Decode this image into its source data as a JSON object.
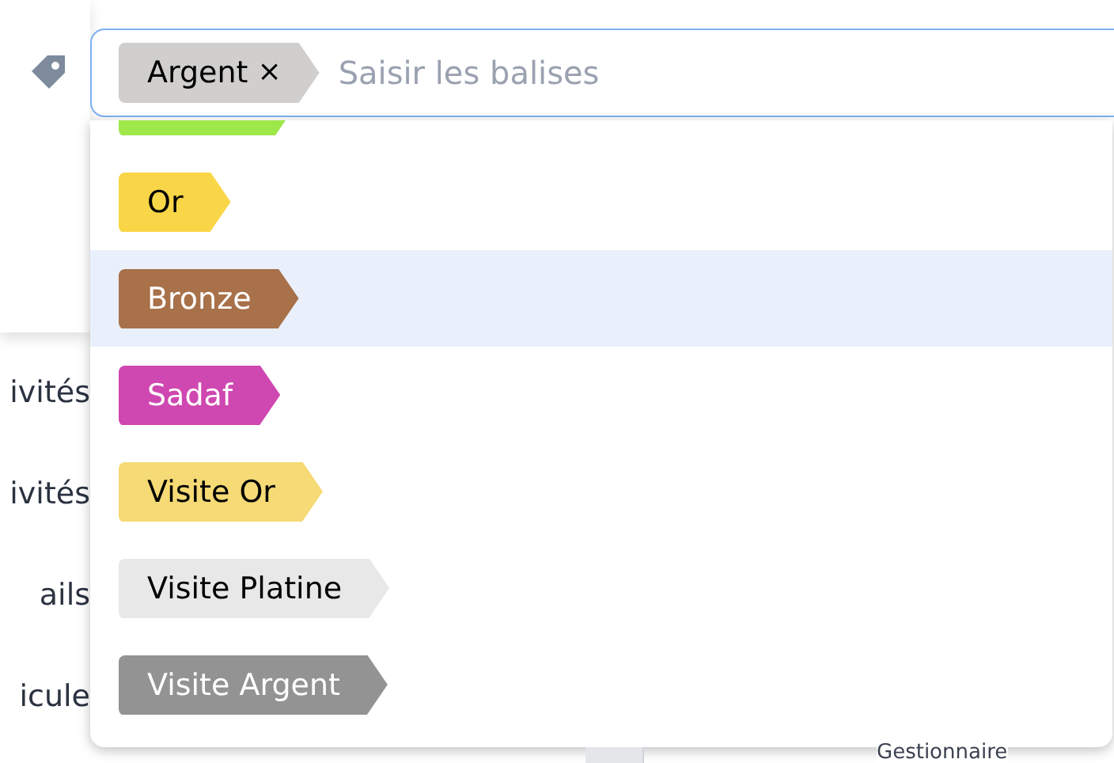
{
  "background": {
    "sidebar_items": [
      "ivités",
      "ivités",
      "ails",
      "icule"
    ],
    "footer_text": "Gestionnaire"
  },
  "tag_field": {
    "chips": [
      {
        "label": "Argent",
        "color": "#d0cfcd",
        "remove": "×"
      }
    ],
    "placeholder": "Saisir les balises"
  },
  "options": [
    {
      "color": "#9ee84a",
      "selected": false
    },
    {
      "label": "Or",
      "color": "#f9d648",
      "selected": false
    },
    {
      "label": "Bronze",
      "color": "#a8714a",
      "selected": true
    },
    {
      "label": "Sadaf",
      "color": "#cf47b0",
      "selected": false
    },
    {
      "label": "Visite Or",
      "color": "#f5da75",
      "selected": false
    },
    {
      "label": "Visite Platine",
      "color": "#e8e8e8",
      "selected": false
    },
    {
      "label": "Visite Argent",
      "color": "#939393",
      "selected": false
    }
  ]
}
